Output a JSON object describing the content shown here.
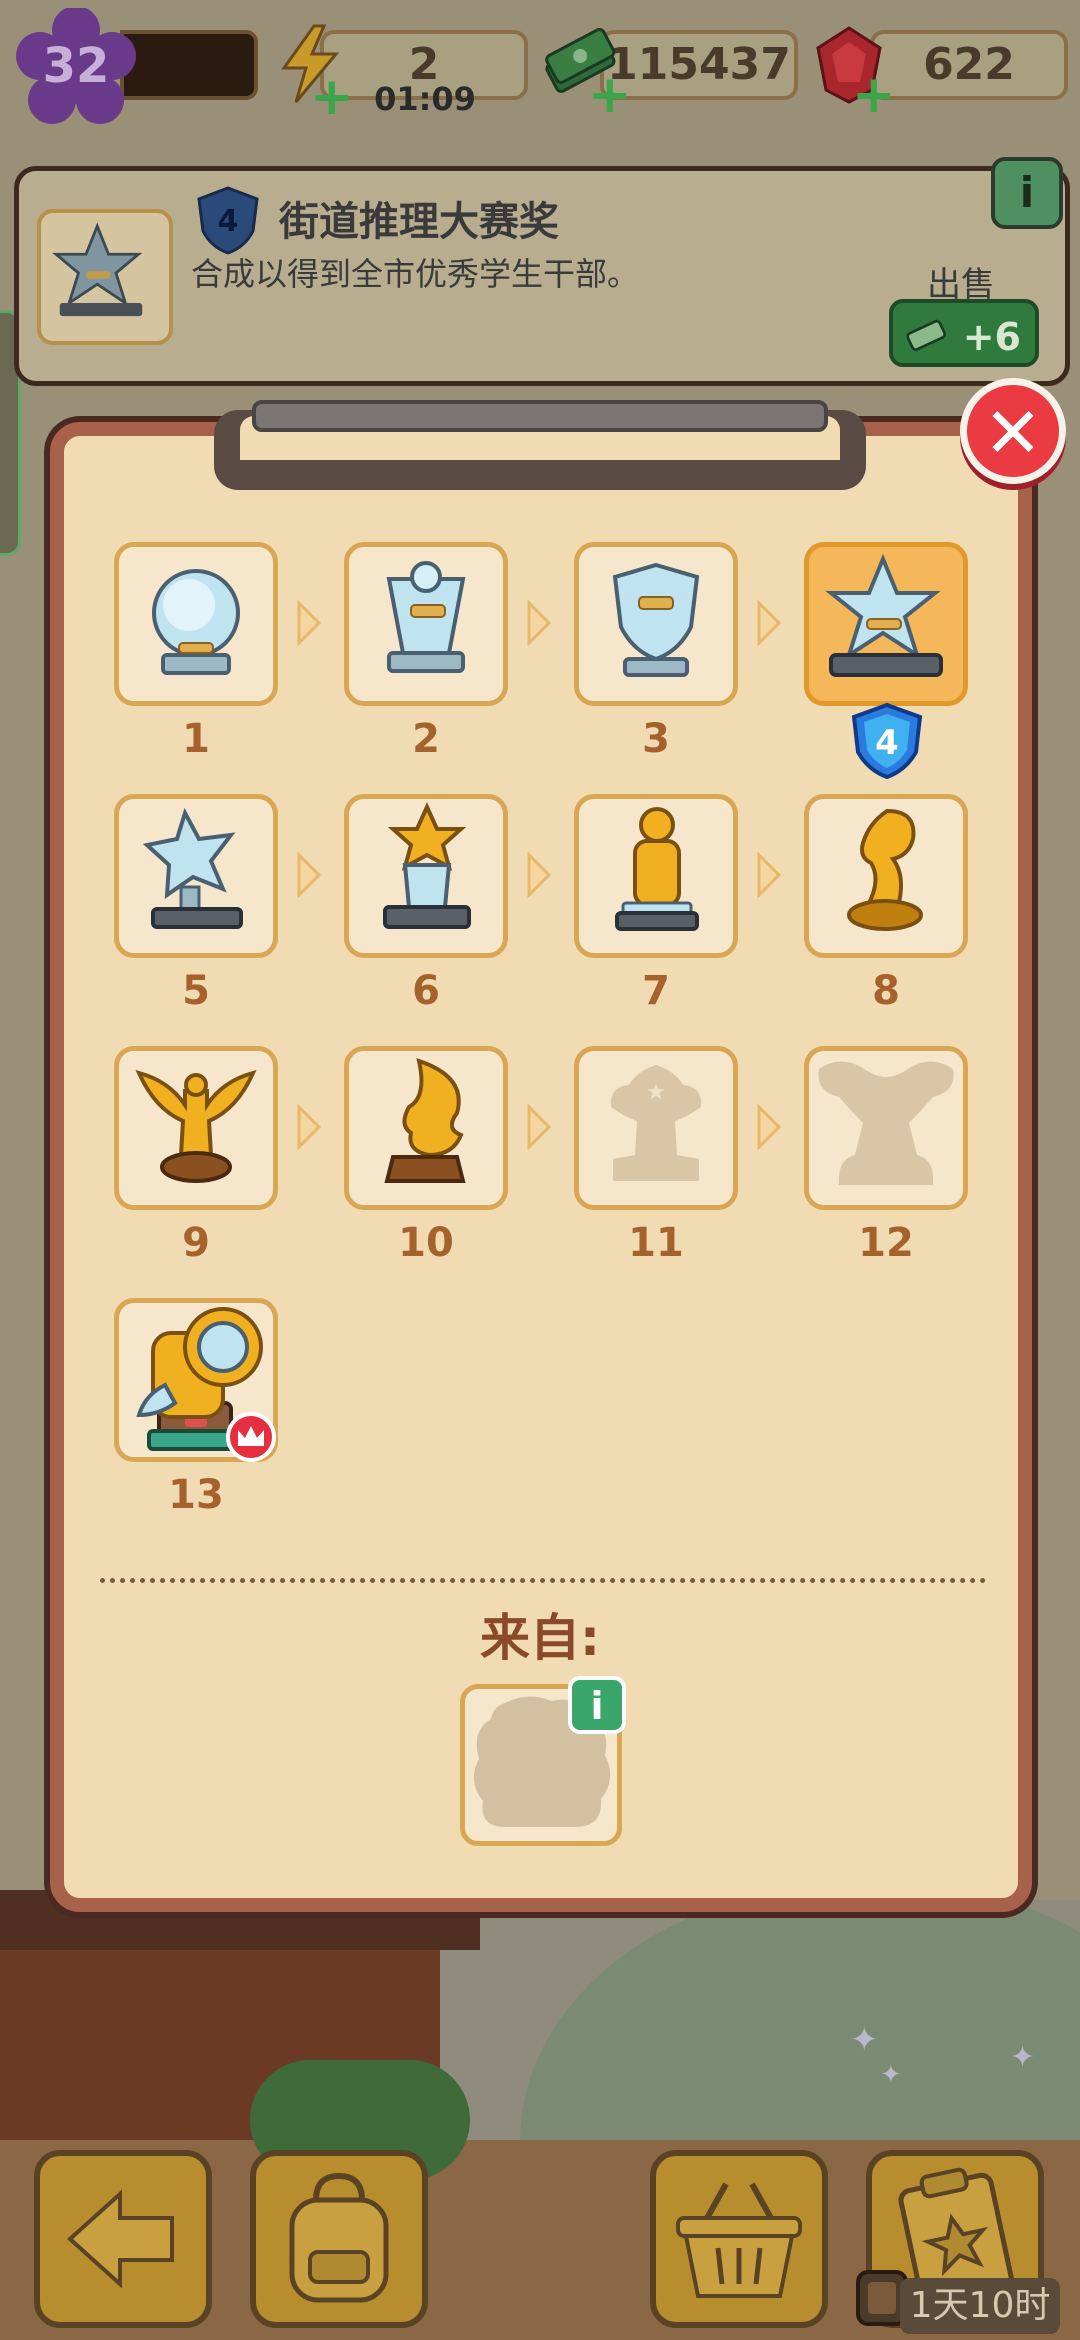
{
  "hud": {
    "level": "32",
    "energy": "2",
    "energy_timer": "01:09",
    "cash": "115437",
    "gems": "622"
  },
  "info": {
    "tier": "4",
    "title": "街道推理大赛奖",
    "description": "合成以得到全市优秀学生干部。",
    "sell_label": "出售",
    "sell_value": "+6"
  },
  "chain": {
    "selected_level": 4,
    "items": [
      {
        "number": "1",
        "icon": "crystal-disc-trophy-icon",
        "state": "unlocked"
      },
      {
        "number": "2",
        "icon": "crystal-cup-trophy-icon",
        "state": "unlocked"
      },
      {
        "number": "3",
        "icon": "crystal-shield-trophy-icon",
        "state": "unlocked"
      },
      {
        "number": "4",
        "icon": "crystal-star-trophy-icon",
        "state": "selected"
      },
      {
        "number": "5",
        "icon": "crystal-star-statue-icon",
        "state": "unlocked"
      },
      {
        "number": "6",
        "icon": "gold-star-crystal-trophy-icon",
        "state": "unlocked"
      },
      {
        "number": "7",
        "icon": "gold-figure-trophy-icon",
        "state": "unlocked"
      },
      {
        "number": "8",
        "icon": "gold-chess-knight-trophy-icon",
        "state": "unlocked"
      },
      {
        "number": "9",
        "icon": "gold-winged-statue-icon",
        "state": "unlocked"
      },
      {
        "number": "10",
        "icon": "gold-flame-trophy-icon",
        "state": "unlocked"
      },
      {
        "number": "11",
        "icon": "locked-silhouette-icon",
        "state": "locked"
      },
      {
        "number": "12",
        "icon": "locked-silhouette-icon",
        "state": "locked"
      },
      {
        "number": "13",
        "icon": "gold-telescope-generator-icon",
        "state": "max"
      }
    ],
    "tier_badge": "4"
  },
  "from": {
    "label": "来自:",
    "info_icon": "i"
  },
  "close_glyph": "✕",
  "info_glyph": "i",
  "bottom": {
    "timer": "1天10时"
  }
}
